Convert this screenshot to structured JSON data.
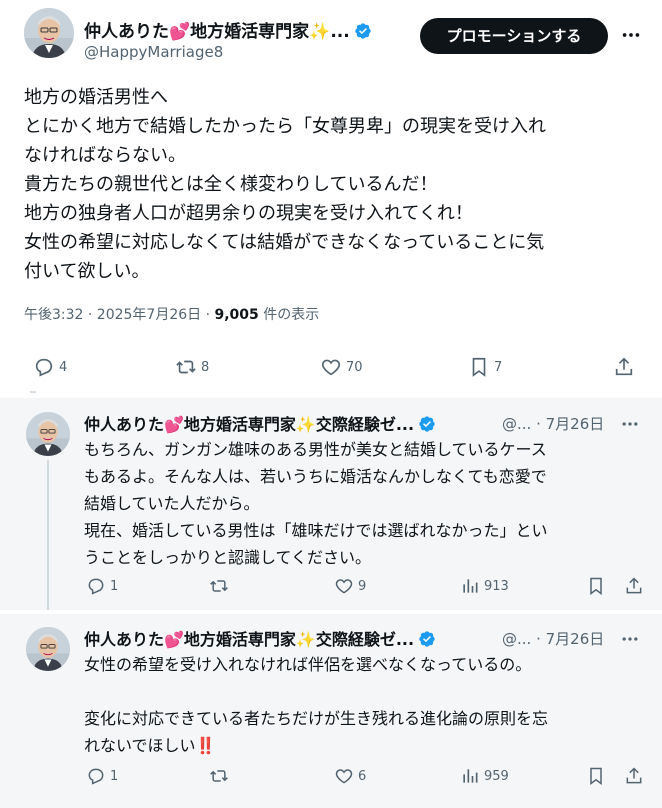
{
  "main_post": {
    "author_name": "仲人ありた💕地方婚活専門家✨...",
    "handle": "@HappyMarriage8",
    "promote_label": "プロモーションする",
    "body_lines": [
      "地方の婚活男性へ",
      "とにかく地方で結婚したかったら「女尊男卑」の現実を受け入れ",
      "なければならない。",
      "貴方たちの親世代とは全く様変わりしているんだ！",
      "地方の独身者人口が超男余りの現実を受け入れてくれ！",
      "女性の希望に対応しなくては結婚ができなくなっていることに気",
      "付いて欲しい。"
    ],
    "time": "午後3:32 · 2025年7月26日 · ",
    "views": "9,005",
    "views_suffix": " 件の表示",
    "stats": {
      "replies": "4",
      "reposts": "8",
      "likes": "70",
      "bookmarks": "7"
    }
  },
  "replies": [
    {
      "author_name": "仲人ありた💕地方婚活専門家✨交際経験ゼ...",
      "handle_date": "@... · 7月26日",
      "body_lines": [
        "もちろん、ガンガン雄味のある男性が美女と結婚しているケース",
        "もあるよ。そんな人は、若いうちに婚活なんかしなくても恋愛で",
        "結婚していた人だから。",
        "現在、婚活している男性は「雄味だけでは選ばれなかった」とい",
        "うことをしっかりと認識してください。"
      ],
      "stats": {
        "replies": "1",
        "reposts": "",
        "likes": "9",
        "views": "913"
      }
    },
    {
      "author_name": "仲人ありた💕地方婚活専門家✨交際経験ゼ...",
      "handle_date": "@... · 7月26日",
      "body_lines": [
        "女性の希望を受け入れなければ伴侶を選べなくなっているの。",
        "",
        "変化に対応できている者たちだけが生き残れる進化論の原則を忘",
        "れないでほしい‼️"
      ],
      "stats": {
        "replies": "1",
        "reposts": "",
        "likes": "6",
        "views": "959"
      }
    }
  ],
  "colors": {
    "accent_blue": "#1d9bf0",
    "text": "#0f1419",
    "muted": "#536471"
  }
}
